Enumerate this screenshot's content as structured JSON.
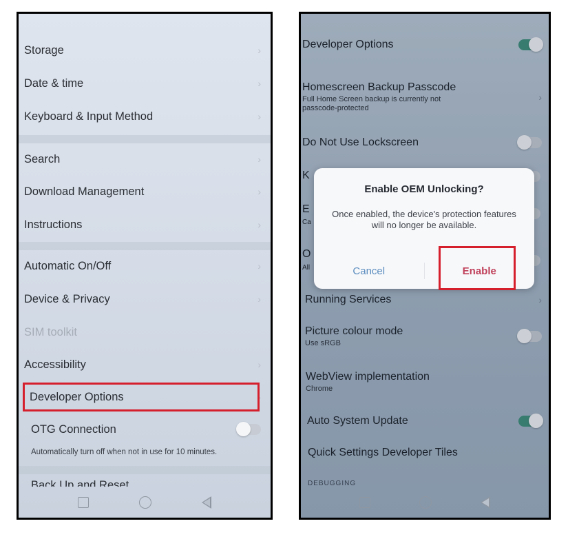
{
  "left_screen": {
    "items": [
      {
        "label": "Storage"
      },
      {
        "label": "Date & time"
      },
      {
        "label": "Keyboard & Input Method"
      },
      {
        "label": "Search"
      },
      {
        "label": "Download Management"
      },
      {
        "label": "Instructions"
      },
      {
        "label": "Automatic On/Off"
      },
      {
        "label": "Device & Privacy"
      },
      {
        "label": "SIM toolkit"
      },
      {
        "label": "Accessibility"
      },
      {
        "label": "Developer Options"
      },
      {
        "label": "OTG Connection"
      }
    ],
    "otg_subtext": "Automatically turn off when not in use for 10 minutes.",
    "cut_off_row": "Back Up and Reset"
  },
  "right_screen": {
    "items": [
      {
        "title": "Developer Options",
        "toggle": "on"
      },
      {
        "title": "Homescreen Backup Passcode",
        "subtitle": "Full Home Screen backup is currently not passcode-protected"
      },
      {
        "title": "Do Not Use Lockscreen",
        "toggle": "off"
      },
      {
        "title": "Running Services"
      },
      {
        "title": "Picture colour mode",
        "subtitle": "Use sRGB",
        "toggle": "off"
      },
      {
        "title": "WebView implementation",
        "subtitle": "Chrome"
      },
      {
        "title": "Auto System Update",
        "toggle": "on"
      },
      {
        "title": "Quick Settings Developer Tiles"
      }
    ],
    "section_header": "DEBUGGING",
    "hidden_letters": [
      "K",
      "E",
      "O"
    ],
    "hidden_sub_letters": [
      "Ca",
      "All"
    ],
    "dialog": {
      "title": "Enable OEM Unlocking?",
      "message": "Once enabled, the device's protection features will no longer be available.",
      "cancel_label": "Cancel",
      "enable_label": "Enable"
    }
  },
  "colors": {
    "highlight": "#d61f2c",
    "toggle_on": "#3f8f7a",
    "enable_text": "#c0405a",
    "cancel_text": "#5b8dbf"
  }
}
